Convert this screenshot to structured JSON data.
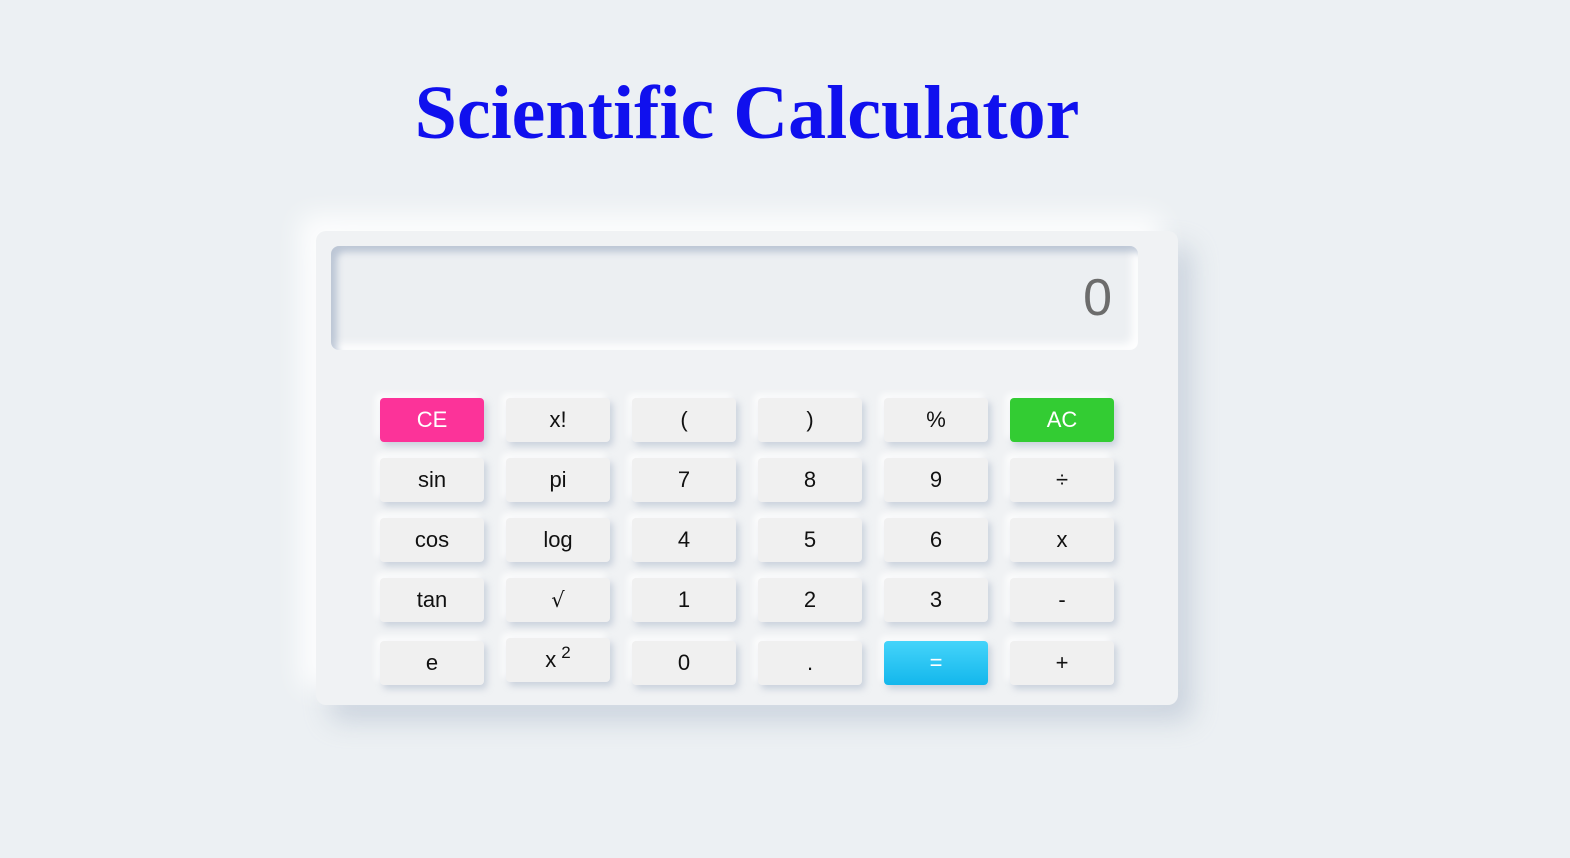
{
  "title": "Scientific Calculator",
  "display": {
    "value": "0"
  },
  "colors": {
    "title": "#1010ee",
    "background": "#ecf0f3",
    "clear_entry": "#fc3399",
    "all_clear": "#33cc33",
    "equals": "#13b7ec"
  },
  "keys": {
    "ce": "CE",
    "factorial": "x!",
    "open_paren": "(",
    "close_paren": ")",
    "percent": "%",
    "ac": "AC",
    "sin": "sin",
    "pi": "pi",
    "seven": "7",
    "eight": "8",
    "nine": "9",
    "divide": "÷",
    "cos": "cos",
    "log": "log",
    "four": "4",
    "five": "5",
    "six": "6",
    "multiply": "x",
    "tan": "tan",
    "sqrt": "√",
    "one": "1",
    "two": "2",
    "three": "3",
    "minus": "-",
    "e": "e",
    "square_base": "x",
    "square_exp": "2",
    "zero": "0",
    "decimal": ".",
    "equals": "=",
    "plus": "+"
  }
}
